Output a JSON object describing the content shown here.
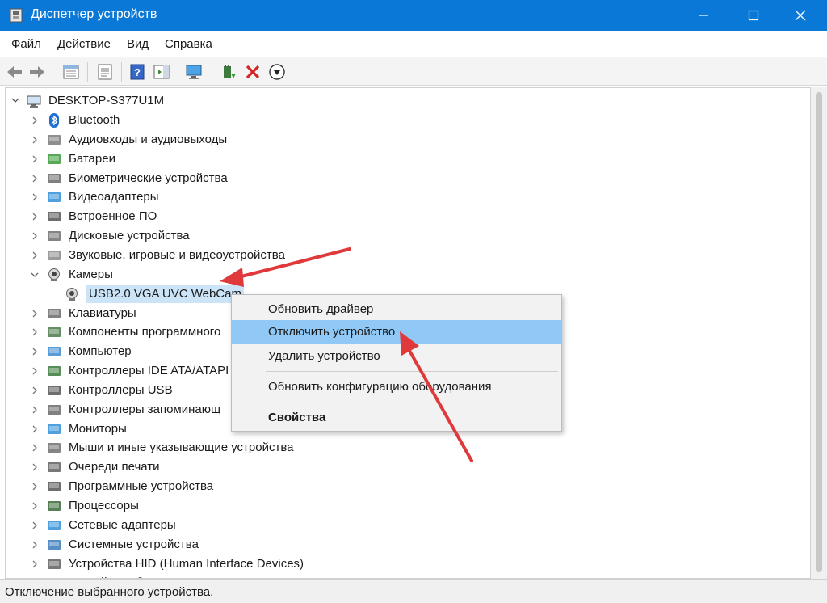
{
  "window": {
    "title": "Диспетчер устройств"
  },
  "menu": {
    "items": [
      "Файл",
      "Действие",
      "Вид",
      "Справка"
    ]
  },
  "toolbar": {
    "buttons": [
      "back-icon",
      "forward-icon",
      "show-hide-tree-icon",
      "properties-icon",
      "help-icon",
      "action-pane-icon",
      "monitor-scan-icon",
      "update-driver-icon",
      "uninstall-icon",
      "disable-icon"
    ]
  },
  "tree": {
    "root": "DESKTOP-S377U1M",
    "categories": [
      {
        "label": "Bluetooth",
        "icon": "bluetooth-icon"
      },
      {
        "label": "Аудиовходы и аудиовыходы",
        "icon": "speaker-icon"
      },
      {
        "label": "Батареи",
        "icon": "battery-icon"
      },
      {
        "label": "Биометрические устройства",
        "icon": "fingerprint-icon"
      },
      {
        "label": "Видеоадаптеры",
        "icon": "display-adapter-icon"
      },
      {
        "label": "Встроенное ПО",
        "icon": "firmware-icon"
      },
      {
        "label": "Дисковые устройства",
        "icon": "disk-icon"
      },
      {
        "label": "Звуковые, игровые и видеоустройства",
        "icon": "sound-icon"
      },
      {
        "label": "Камеры",
        "icon": "camera-icon",
        "expanded": true
      },
      {
        "label": "USB2.0 VGA UVC WebCam",
        "icon": "webcam-icon",
        "child": true
      },
      {
        "label": "Клавиатуры",
        "icon": "keyboard-icon"
      },
      {
        "label": "Компоненты программного",
        "icon": "software-component-icon"
      },
      {
        "label": "Компьютер",
        "icon": "computer-icon"
      },
      {
        "label": "Контроллеры IDE ATA/ATAPI",
        "icon": "ide-controller-icon"
      },
      {
        "label": "Контроллеры USB",
        "icon": "usb-icon"
      },
      {
        "label": "Контроллеры запоминающ",
        "icon": "storage-controller-icon"
      },
      {
        "label": "Мониторы",
        "icon": "monitor-icon"
      },
      {
        "label": "Мыши и иные указывающие устройства",
        "icon": "mouse-icon"
      },
      {
        "label": "Очереди печати",
        "icon": "printer-icon"
      },
      {
        "label": "Программные устройства",
        "icon": "software-device-icon"
      },
      {
        "label": "Процессоры",
        "icon": "processor-icon"
      },
      {
        "label": "Сетевые адаптеры",
        "icon": "network-adapter-icon"
      },
      {
        "label": "Системные устройства",
        "icon": "system-device-icon"
      },
      {
        "label": "Устройства HID (Human Interface Devices)",
        "icon": "hid-icon"
      },
      {
        "label": "Устройства безопасности",
        "icon": "security-device-icon"
      }
    ]
  },
  "context_menu": {
    "items": [
      {
        "label": "Обновить драйвер"
      },
      {
        "label": "Отключить устройство",
        "highlighted": true
      },
      {
        "label": "Удалить устройство"
      },
      {
        "label": "Обновить конфигурацию оборудования"
      },
      {
        "label": "Свойства",
        "bold": true
      }
    ]
  },
  "status": {
    "text": "Отключение выбранного устройства."
  },
  "colors": {
    "titlebar": "#0a78d7",
    "highlight": "#90c8f6",
    "arrow": "#e0393b"
  }
}
